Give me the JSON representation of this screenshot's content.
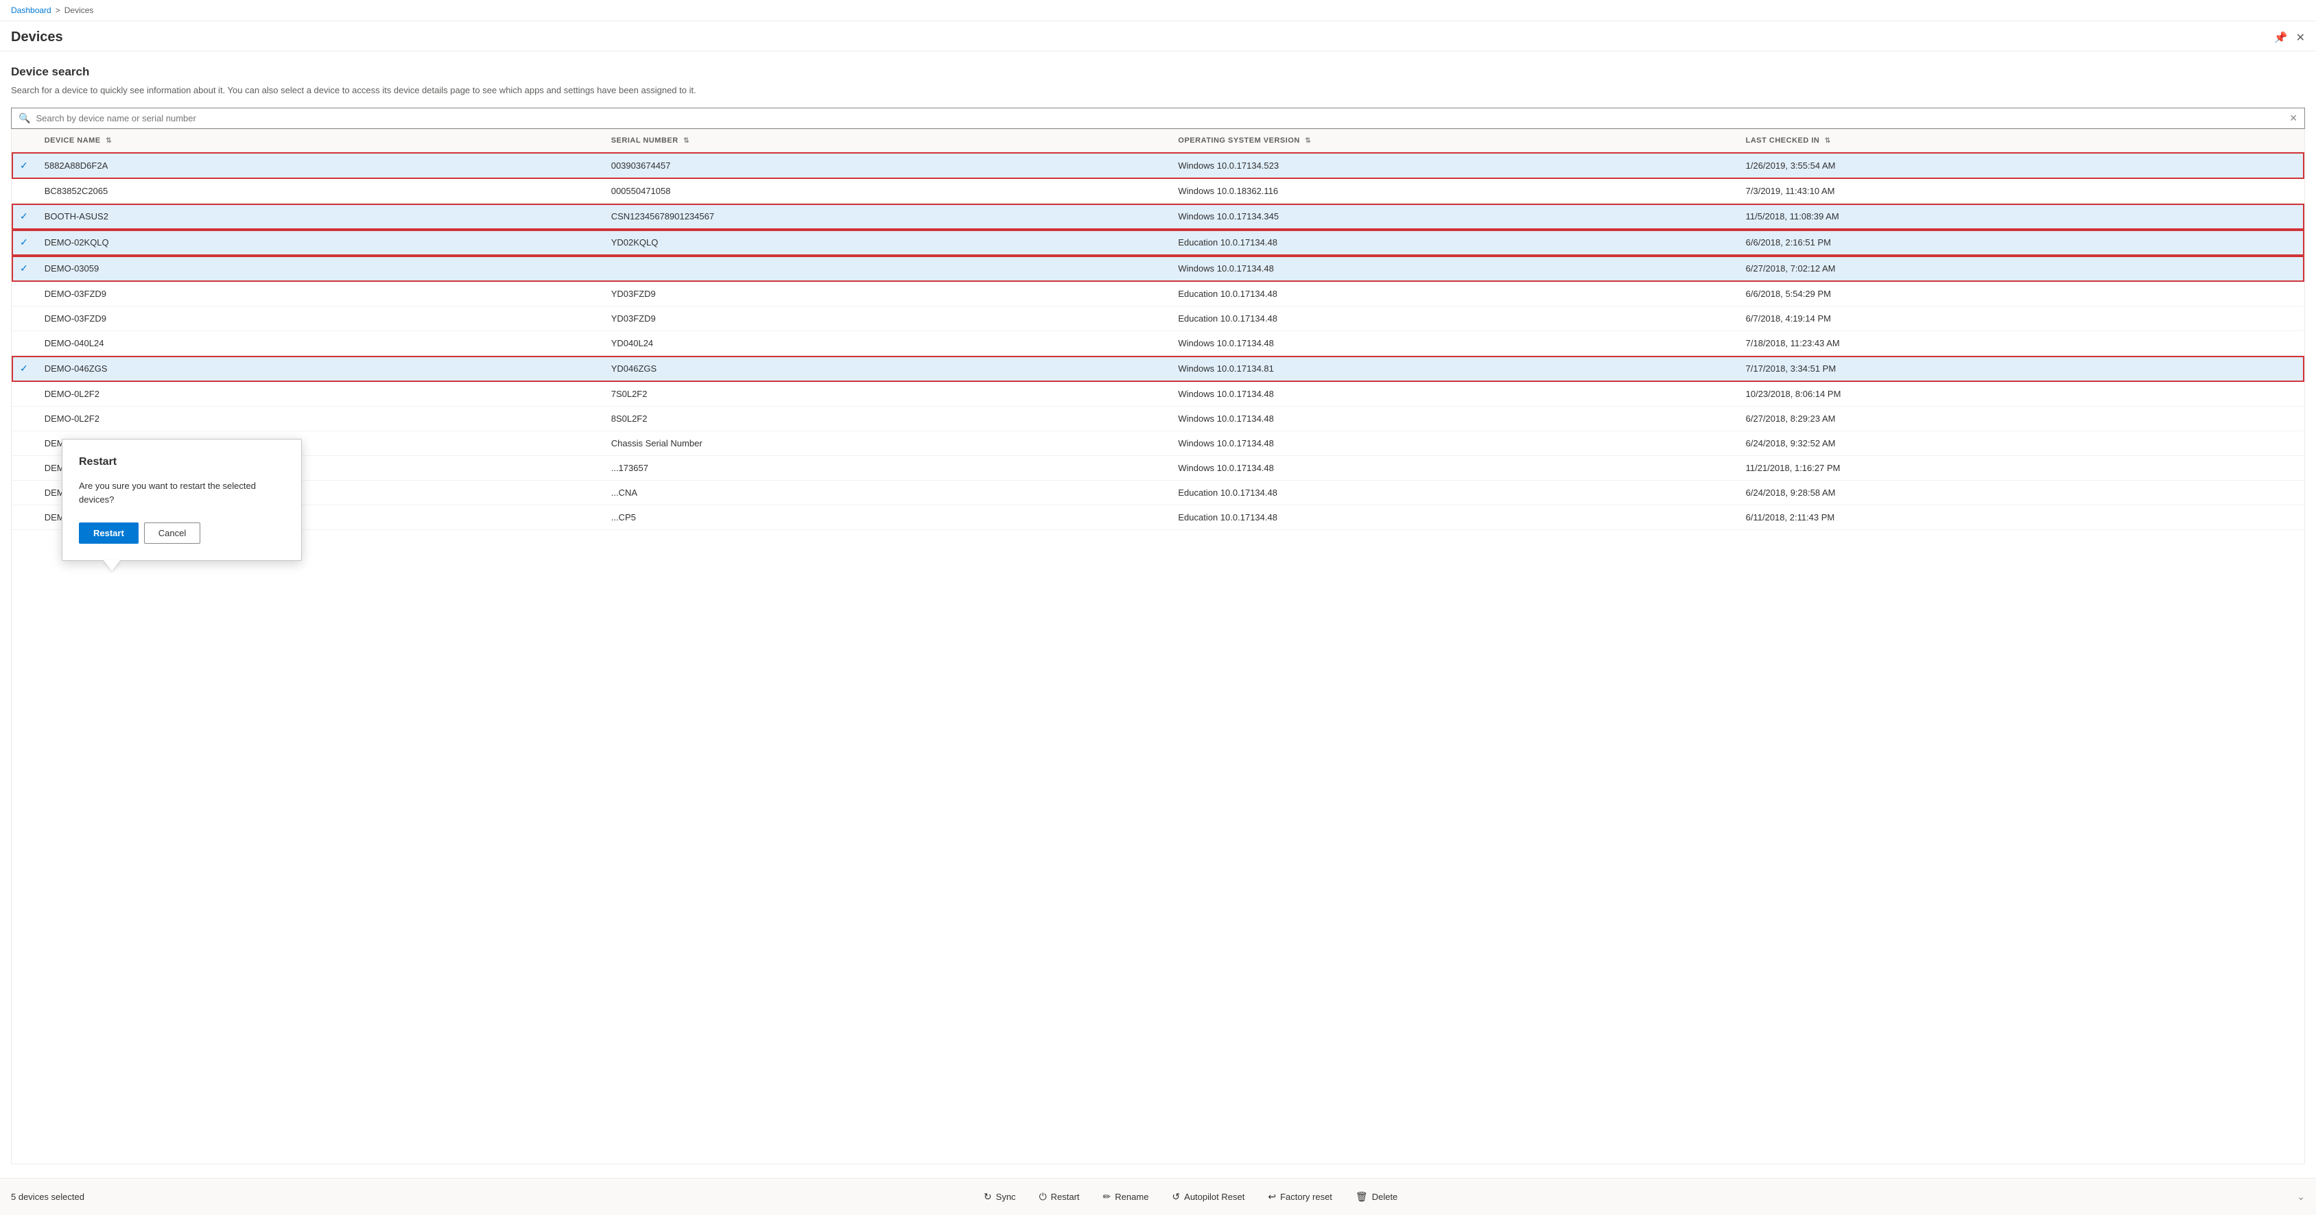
{
  "breadcrumb": {
    "parent": "Dashboard",
    "separator": ">",
    "current": "Devices"
  },
  "pageHeader": {
    "title": "Devices",
    "pinIcon": "📌",
    "closeIcon": "✕"
  },
  "deviceSearch": {
    "sectionTitle": "Device search",
    "sectionDesc": "Search for a device to quickly see information about it. You can also select a device to access its device details page to see which apps and settings have been assigned to it.",
    "searchPlaceholder": "Search by device name or serial number"
  },
  "table": {
    "columns": [
      {
        "key": "device_name",
        "label": "DEVICE NAME"
      },
      {
        "key": "serial_number",
        "label": "SERIAL NUMBER"
      },
      {
        "key": "os_version",
        "label": "OPERATING SYSTEM VERSION"
      },
      {
        "key": "last_checked",
        "label": "LAST CHECKED IN"
      }
    ],
    "rows": [
      {
        "id": 1,
        "selected": true,
        "highlighted": true,
        "device_name": "5882A88D6F2A",
        "serial_number": "003903674457",
        "os_version": "Windows 10.0.17134.523",
        "last_checked": "1/26/2019, 3:55:54 AM"
      },
      {
        "id": 2,
        "selected": false,
        "highlighted": false,
        "device_name": "BC83852C2065",
        "serial_number": "000550471058",
        "os_version": "Windows 10.0.18362.116",
        "last_checked": "7/3/2019, 11:43:10 AM"
      },
      {
        "id": 3,
        "selected": true,
        "highlighted": true,
        "device_name": "BOOTH-ASUS2",
        "serial_number": "CSN12345678901234567",
        "os_version": "Windows 10.0.17134.345",
        "last_checked": "11/5/2018, 11:08:39 AM"
      },
      {
        "id": 4,
        "selected": true,
        "highlighted": true,
        "device_name": "DEMO-02KQLQ",
        "serial_number": "YD02KQLQ",
        "os_version": "Education 10.0.17134.48",
        "last_checked": "6/6/2018, 2:16:51 PM"
      },
      {
        "id": 5,
        "selected": true,
        "highlighted": true,
        "device_name": "DEMO-03059",
        "serial_number": "",
        "os_version": "Windows 10.0.17134.48",
        "last_checked": "6/27/2018, 7:02:12 AM"
      },
      {
        "id": 6,
        "selected": false,
        "highlighted": false,
        "device_name": "DEMO-03FZD9",
        "serial_number": "YD03FZD9",
        "os_version": "Education 10.0.17134.48",
        "last_checked": "6/6/2018, 5:54:29 PM"
      },
      {
        "id": 7,
        "selected": false,
        "highlighted": false,
        "device_name": "DEMO-03FZD9",
        "serial_number": "YD03FZD9",
        "os_version": "Education 10.0.17134.48",
        "last_checked": "6/7/2018, 4:19:14 PM"
      },
      {
        "id": 8,
        "selected": false,
        "highlighted": false,
        "device_name": "DEMO-040L24",
        "serial_number": "YD040L24",
        "os_version": "Windows 10.0.17134.48",
        "last_checked": "7/18/2018, 11:23:43 AM"
      },
      {
        "id": 9,
        "selected": true,
        "highlighted": true,
        "device_name": "DEMO-046ZGS",
        "serial_number": "YD046ZGS",
        "os_version": "Windows 10.0.17134.81",
        "last_checked": "7/17/2018, 3:34:51 PM"
      },
      {
        "id": 10,
        "selected": false,
        "highlighted": false,
        "device_name": "DEMO-0L2F2",
        "serial_number": "7S0L2F2",
        "os_version": "Windows 10.0.17134.48",
        "last_checked": "10/23/2018, 8:06:14 PM"
      },
      {
        "id": 11,
        "selected": false,
        "highlighted": false,
        "device_name": "DEMO-0L2F2",
        "serial_number": "8S0L2F2",
        "os_version": "Windows 10.0.17134.48",
        "last_checked": "6/27/2018, 8:29:23 AM"
      },
      {
        "id": 12,
        "selected": false,
        "highlighted": false,
        "device_name": "DEMO-14S00",
        "serial_number": "Chassis Serial Number",
        "os_version": "Windows 10.0.17134.48",
        "last_checked": "6/24/2018, 9:32:52 AM"
      },
      {
        "id": 13,
        "selected": false,
        "highlighted": false,
        "device_name": "DEMO-173...",
        "serial_number": "...173657",
        "os_version": "Windows 10.0.17134.48",
        "last_checked": "11/21/2018, 1:16:27 PM"
      },
      {
        "id": 14,
        "selected": false,
        "highlighted": false,
        "device_name": "DEMO-1Q0...",
        "serial_number": "...CNA",
        "os_version": "Education 10.0.17134.48",
        "last_checked": "6/24/2018, 9:28:58 AM"
      },
      {
        "id": 15,
        "selected": false,
        "highlighted": false,
        "device_name": "DEMO-1Q0...",
        "serial_number": "...CP5",
        "os_version": "Education 10.0.17134.48",
        "last_checked": "6/11/2018, 2:11:43 PM"
      }
    ]
  },
  "bottomBar": {
    "selectionText": "5 devices selected",
    "actions": [
      {
        "key": "sync",
        "icon": "↻",
        "label": "Sync"
      },
      {
        "key": "restart",
        "icon": "⏻",
        "label": "Restart"
      },
      {
        "key": "rename",
        "icon": "✏",
        "label": "Rename"
      },
      {
        "key": "autopilot-reset",
        "icon": "↺",
        "label": "Autopilot Reset"
      },
      {
        "key": "factory-reset",
        "icon": "↩",
        "label": "Factory reset"
      },
      {
        "key": "delete",
        "icon": "🗑",
        "label": "Delete"
      }
    ],
    "chevronIcon": "⌄"
  },
  "modal": {
    "title": "Restart",
    "body": "Are you sure you want to restart the selected devices?",
    "confirmLabel": "Restart",
    "cancelLabel": "Cancel"
  }
}
